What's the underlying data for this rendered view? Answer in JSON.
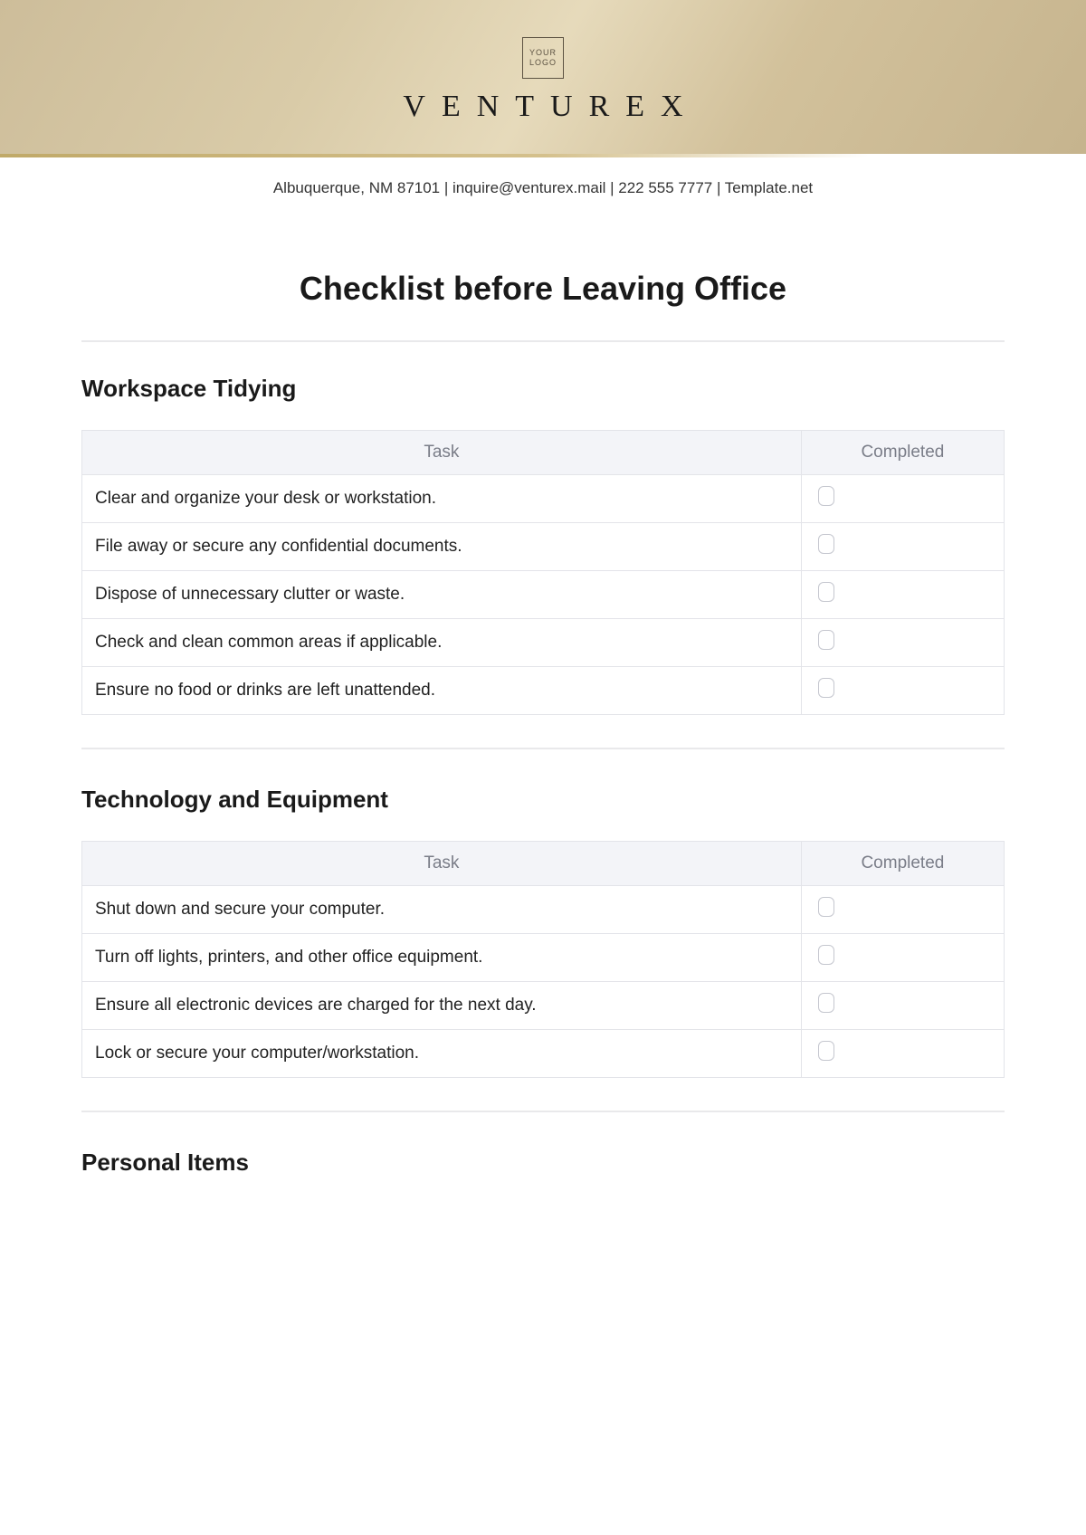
{
  "header": {
    "logo_line1": "YOUR",
    "logo_line2": "LOGO",
    "brand": "VENTUREX",
    "contact": "Albuquerque, NM 87101 | inquire@venturex.mail | 222 555 7777 | Template.net"
  },
  "title": "Checklist before Leaving Office",
  "table_headers": {
    "task": "Task",
    "completed": "Completed"
  },
  "sections": [
    {
      "heading": "Workspace Tidying",
      "tasks": [
        "Clear and organize your desk or workstation.",
        "File away or secure any confidential documents.",
        "Dispose of unnecessary clutter or waste.",
        "Check and clean common areas if applicable.",
        "Ensure no food or drinks are left unattended."
      ]
    },
    {
      "heading": "Technology and Equipment",
      "tasks": [
        "Shut down and secure your computer.",
        "Turn off lights, printers, and other office equipment.",
        "Ensure all electronic devices are charged for the next day.",
        "Lock or secure your computer/workstation."
      ]
    },
    {
      "heading": "Personal Items",
      "tasks": []
    }
  ]
}
